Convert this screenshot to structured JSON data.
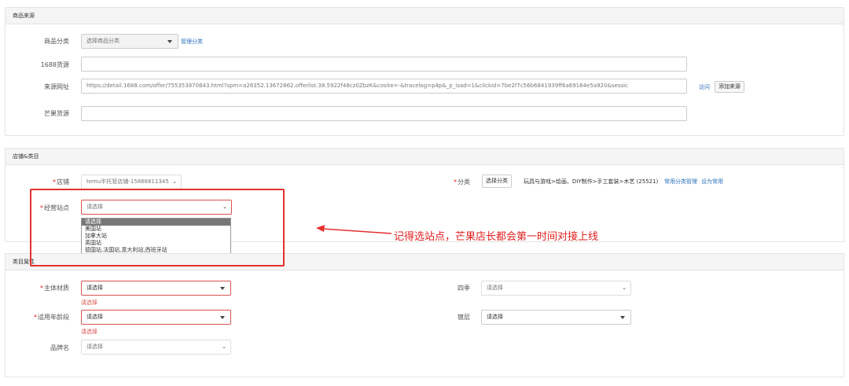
{
  "source": {
    "header": "商品来源",
    "category_label": "商品分类",
    "category_value": "选择商品分类",
    "manage_category": "管理分类",
    "source1688_label": "1688货源",
    "source1688_value": "",
    "url_label": "来源网址",
    "url_value": "https://detail.1688.com/offer/755353870643.html?spm=a26352.13672862.offerlist.38.5922f48cz0ZbzK&cosite=-&tracelog=p4p&_p_isad=1&clickid=7be2f7c56b6841939ff6a69164e5a920&sessic",
    "visit_link": "访问",
    "add_source_button": "添加来源",
    "mango_label": "芒果货源",
    "mango_value": ""
  },
  "store": {
    "header": "店铺&类目",
    "store_label": "店铺",
    "store_value": "temu半托管店铺-15868811345",
    "site_label": "经营站点",
    "site_value": "请选择",
    "site_options": [
      "请选择",
      "美国站",
      "加拿大站",
      "英国站",
      "德国站,法国站,意大利站,西班牙站"
    ],
    "category_label": "分类",
    "choose_category_button": "选择分类",
    "category_path": "玩具与游戏>绘画、DIY制作>手工套装>木艺 (25521)",
    "common_category_manage": "常用分类管理",
    "set_common": "设为常用"
  },
  "attributes": {
    "header": "类目属性",
    "material_label": "主体材质",
    "material_value": "请选择",
    "material_error": "请选择",
    "season_label": "四季",
    "season_value": "请选择",
    "age_label": "适用年龄段",
    "age_value": "请选择",
    "age_error": "请选择",
    "coating_label": "镀层",
    "coating_value": "请选择",
    "brand_label": "品牌名",
    "brand_value": "请选择"
  },
  "annotation": "记得选站点，芒果店长都会第一时间对接上线",
  "colors": {
    "accent_red": "#e53030",
    "link_blue": "#2a6fb8",
    "error_red": "#d9534f"
  }
}
